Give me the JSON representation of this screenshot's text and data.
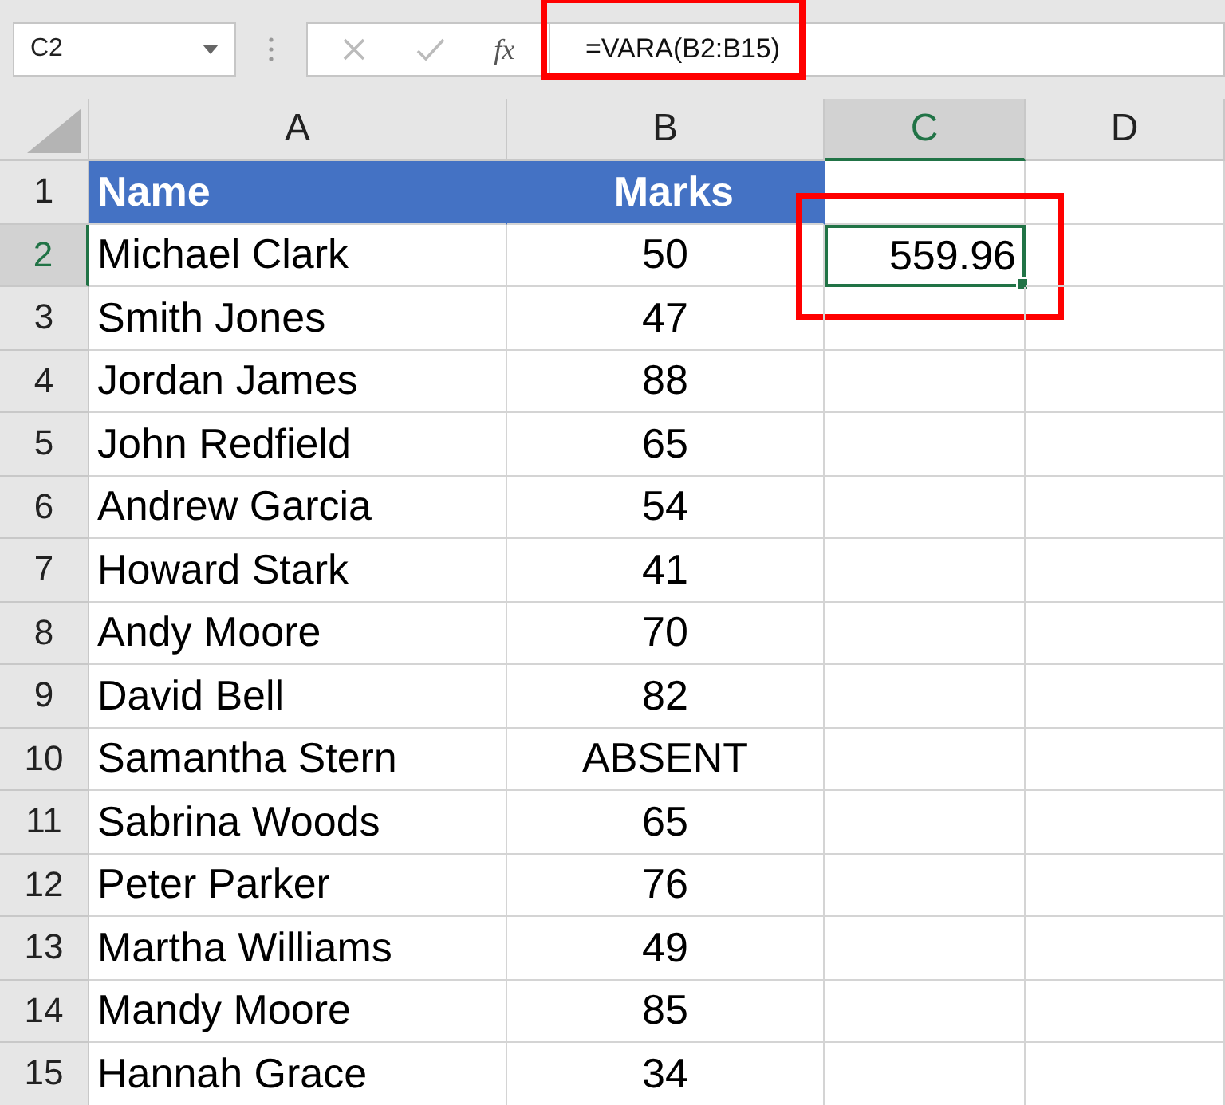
{
  "name_box": "C2",
  "formula_bar": {
    "fx_label": "fx",
    "formula": "=VARA(B2:B15)",
    "highlighted": true
  },
  "columns": [
    {
      "label": "A",
      "selected": false
    },
    {
      "label": "B",
      "selected": false
    },
    {
      "label": "C",
      "selected": true
    },
    {
      "label": "D",
      "selected": false
    }
  ],
  "rows": [
    {
      "number": "1",
      "selected": false,
      "kind": "header",
      "name": "Name",
      "marks": "Marks"
    },
    {
      "number": "2",
      "selected": true,
      "kind": "data",
      "name": "Michael Clark",
      "marks": "50",
      "result": "559.96",
      "result_highlighted": true
    },
    {
      "number": "3",
      "selected": false,
      "kind": "data",
      "name": "Smith Jones",
      "marks": "47"
    },
    {
      "number": "4",
      "selected": false,
      "kind": "data",
      "name": "Jordan James",
      "marks": "88"
    },
    {
      "number": "5",
      "selected": false,
      "kind": "data",
      "name": "John Redfield",
      "marks": "65"
    },
    {
      "number": "6",
      "selected": false,
      "kind": "data",
      "name": "Andrew Garcia",
      "marks": "54"
    },
    {
      "number": "7",
      "selected": false,
      "kind": "data",
      "name": "Howard Stark",
      "marks": "41"
    },
    {
      "number": "8",
      "selected": false,
      "kind": "data",
      "name": "Andy Moore",
      "marks": "70"
    },
    {
      "number": "9",
      "selected": false,
      "kind": "data",
      "name": "David Bell",
      "marks": "82"
    },
    {
      "number": "10",
      "selected": false,
      "kind": "data",
      "name": "Samantha Stern",
      "marks": "ABSENT"
    },
    {
      "number": "11",
      "selected": false,
      "kind": "data",
      "name": "Sabrina Woods",
      "marks": "65"
    },
    {
      "number": "12",
      "selected": false,
      "kind": "data",
      "name": "Peter Parker",
      "marks": "76"
    },
    {
      "number": "13",
      "selected": false,
      "kind": "data",
      "name": "Martha Williams",
      "marks": "49"
    },
    {
      "number": "14",
      "selected": false,
      "kind": "data",
      "name": "Mandy Moore",
      "marks": "85"
    },
    {
      "number": "15",
      "selected": false,
      "kind": "data",
      "name": "Hannah Grace",
      "marks": "34"
    }
  ]
}
